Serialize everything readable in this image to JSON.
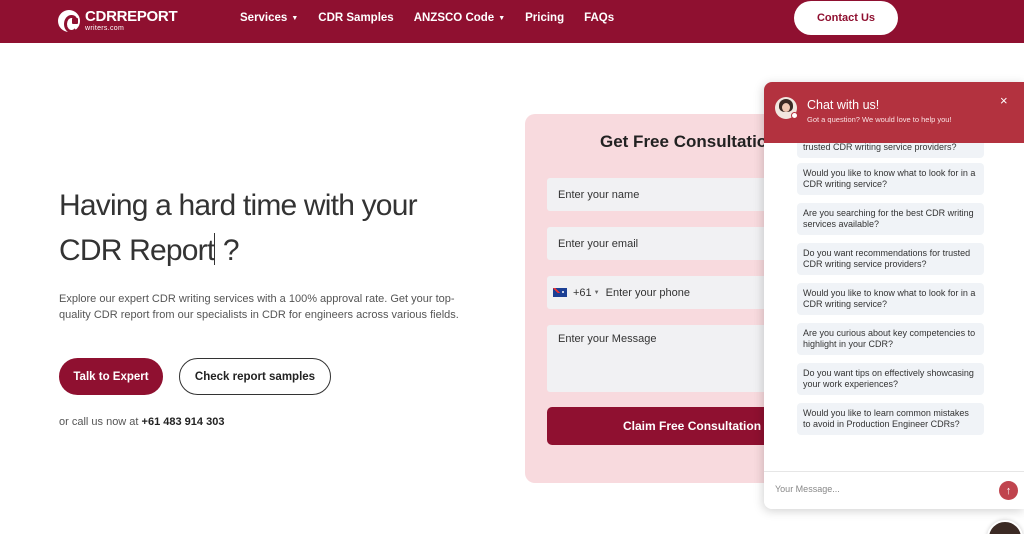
{
  "header": {
    "logo_title": "CDRREPORT",
    "logo_sub": "writers.com",
    "nav": [
      {
        "label": "Services",
        "caret": true
      },
      {
        "label": "CDR Samples",
        "caret": false
      },
      {
        "label": "ANZSCO Code",
        "caret": true
      },
      {
        "label": "Pricing",
        "caret": false
      },
      {
        "label": "FAQs",
        "caret": false
      }
    ],
    "contact_label": "Contact Us"
  },
  "hero": {
    "title_line1": "Having a hard time with your",
    "title_line2": "CDR Report",
    "title_suffix": "?",
    "description": "Explore our expert CDR writing services with a 100% approval rate. Get your top-quality CDR report from our specialists in CDR for engineers across various fields.",
    "primary_cta": "Talk to Expert",
    "secondary_cta": "Check report samples",
    "call_prefix": "or call us now at",
    "phone": "+61 483 914 303"
  },
  "form": {
    "title": "Get Free Consultation",
    "name_placeholder": "Enter your name",
    "email_placeholder": "Enter your email",
    "phone_code": "+61",
    "phone_placeholder": "Enter your phone",
    "message_placeholder": "Enter your Message",
    "submit_label": "Claim Free Consultation"
  },
  "chat": {
    "title": "Chat with us!",
    "subtitle": "Got a question? We would love to help you!",
    "close_icon": "×",
    "suggestions": [
      "trusted CDR writing service providers?",
      "Would you like to know what to look for in a CDR writing service?",
      "Are you searching for the best CDR writing services available?",
      "Do you want recommendations for trusted CDR writing service providers?",
      "Would you like to know what to look for in a CDR writing service?",
      "Are you curious about key competencies to highlight in your CDR?",
      "Do you want tips on effectively showcasing your work experiences?",
      "Would you like to learn common mistakes to avoid in Production Engineer CDRs?"
    ],
    "input_placeholder": "Your Message...",
    "send_icon": "↑"
  },
  "colors": {
    "brand": "#8f1030",
    "chat_header": "#b3323f",
    "form_bg": "#f8dade"
  }
}
